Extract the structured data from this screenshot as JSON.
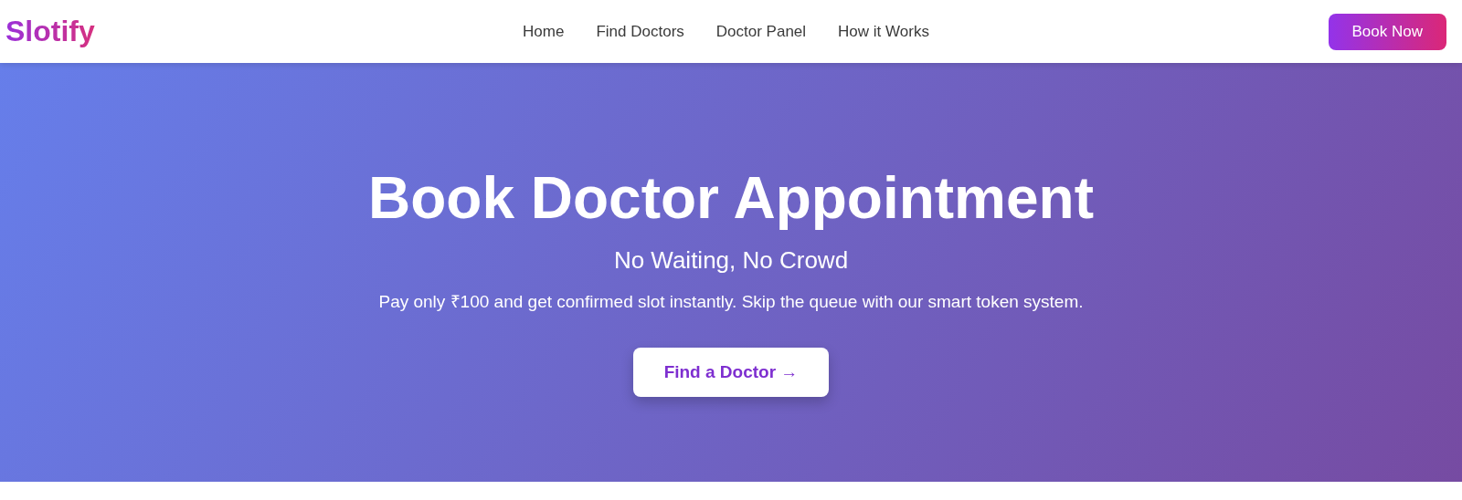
{
  "navbar": {
    "logo": "Slotify",
    "links": [
      {
        "label": "Home"
      },
      {
        "label": "Find Doctors"
      },
      {
        "label": "Doctor Panel"
      },
      {
        "label": "How it Works"
      }
    ],
    "cta": "Book Now"
  },
  "hero": {
    "title": "Book Doctor Appointment",
    "subtitle": "No Waiting, No Crowd",
    "description": "Pay only ₹100 and get confirmed slot instantly. Skip the queue with our smart token system.",
    "button": "Find a Doctor →"
  }
}
